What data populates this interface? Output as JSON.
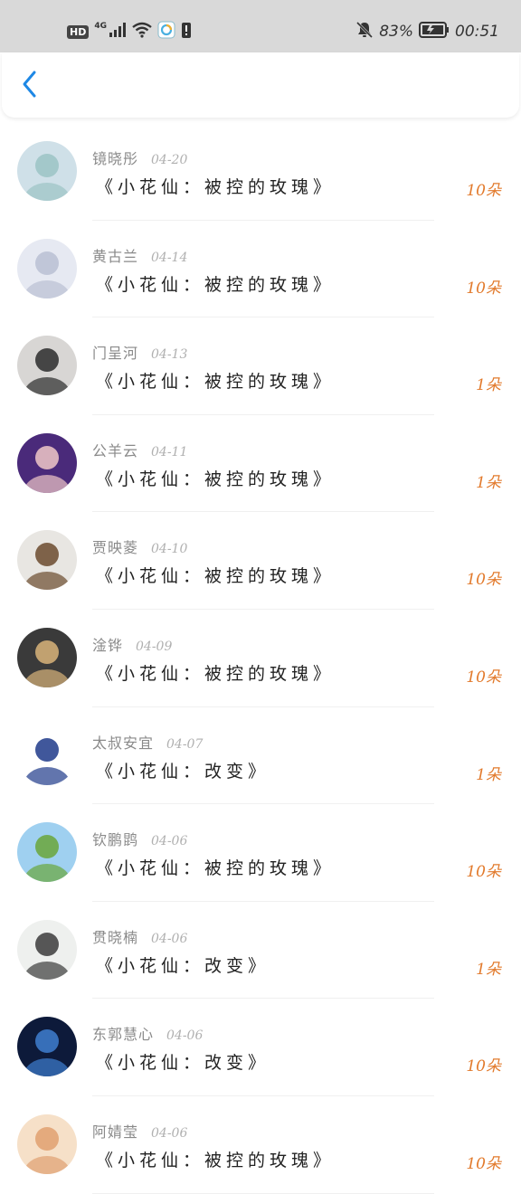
{
  "status_bar": {
    "hd": "HD",
    "network": "4G",
    "battery_percent": "83%",
    "time": "00:51"
  },
  "header": {
    "back_icon": "chevron-left-icon"
  },
  "colors": {
    "accent_blue": "#1e88e5",
    "count_orange": "#e27a2c"
  },
  "gifts": [
    {
      "name": "镜晓彤",
      "date": "04-20",
      "title": "《小花仙：被控的玫瑰》",
      "count": "10朵",
      "avatar_colors": [
        "#cfe0e8",
        "#9bc3c4"
      ]
    },
    {
      "name": "黄古兰",
      "date": "04-14",
      "title": "《小花仙：被控的玫瑰》",
      "count": "10朵",
      "avatar_colors": [
        "#e6e9f2",
        "#b9bfd3"
      ]
    },
    {
      "name": "门呈河",
      "date": "04-13",
      "title": "《小花仙：被控的玫瑰》",
      "count": "1朵",
      "avatar_colors": [
        "#d8d6d4",
        "#2b2b2b"
      ]
    },
    {
      "name": "公羊云",
      "date": "04-11",
      "title": "《小花仙：被控的玫瑰》",
      "count": "1朵",
      "avatar_colors": [
        "#4a2a7a",
        "#f0c8c8"
      ]
    },
    {
      "name": "贾映菱",
      "date": "04-10",
      "title": "《小花仙：被控的玫瑰》",
      "count": "10朵",
      "avatar_colors": [
        "#e8e6e2",
        "#6b4a2e"
      ]
    },
    {
      "name": "淦铧",
      "date": "04-09",
      "title": "《小花仙：被控的玫瑰》",
      "count": "10朵",
      "avatar_colors": [
        "#3a3a3a",
        "#d9b47a"
      ]
    },
    {
      "name": "太叔安宜",
      "date": "04-07",
      "title": "《小花仙：改变》",
      "count": "1朵",
      "avatar_colors": [
        "#ffffff",
        "#1f3a8a"
      ]
    },
    {
      "name": "钦鹏鹍",
      "date": "04-06",
      "title": "《小花仙：被控的玫瑰》",
      "count": "10朵",
      "avatar_colors": [
        "#9fd0f0",
        "#6aa63a"
      ]
    },
    {
      "name": "贯晓楠",
      "date": "04-06",
      "title": "《小花仙：改变》",
      "count": "1朵",
      "avatar_colors": [
        "#eef0ee",
        "#3b3b3b"
      ]
    },
    {
      "name": "东郭慧心",
      "date": "04-06",
      "title": "《小花仙：改变》",
      "count": "10朵",
      "avatar_colors": [
        "#0d1a3a",
        "#3f7fd0"
      ]
    },
    {
      "name": "阿婧莹",
      "date": "04-06",
      "title": "《小花仙：被控的玫瑰》",
      "count": "10朵",
      "avatar_colors": [
        "#f6e0c8",
        "#e0a070"
      ]
    }
  ]
}
